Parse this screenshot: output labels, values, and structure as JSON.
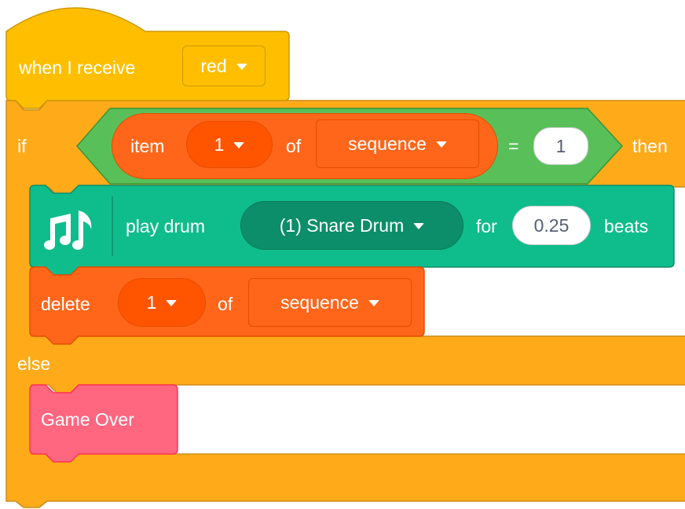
{
  "colors": {
    "events": "#FFBF00",
    "events_border": "#CC9900",
    "control": "#FFAB19",
    "control_border": "#CF8B17",
    "list": "#FF661A",
    "list_field": "#FF5500",
    "list_border": "#E64D00",
    "operator": "#59C059",
    "operator_border": "#389438",
    "music": "#0FBD8C",
    "music_field": "#0B8E69",
    "music_border": "#0B8E69",
    "custom": "#FF6680",
    "custom_border": "#FF3355"
  },
  "hat_block": {
    "label": "when I receive",
    "message": "red"
  },
  "if_block": {
    "if_label": "if",
    "then_label": "then",
    "else_label": "else",
    "condition": {
      "item_label": "item",
      "index": "1",
      "of_label": "of",
      "list": "sequence",
      "equals": "=",
      "compare_value": "1"
    }
  },
  "drum_block": {
    "icon": "music-notes-icon",
    "play_label": "play drum",
    "drum": "(1) Snare Drum",
    "for_label": "for",
    "beats_value": "0.25",
    "beats_label": "beats"
  },
  "delete_block": {
    "delete_label": "delete",
    "index": "1",
    "of_label": "of",
    "list": "sequence"
  },
  "custom_block": {
    "label": "Game Over"
  }
}
